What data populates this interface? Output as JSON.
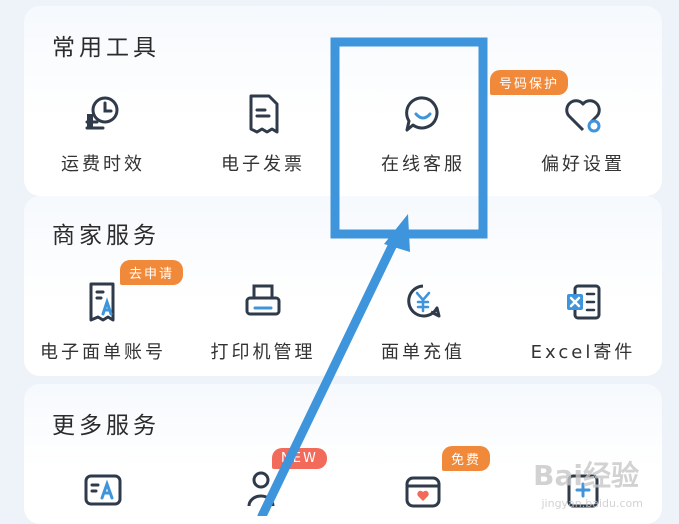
{
  "sections": [
    {
      "title": "常用工具",
      "items": [
        {
          "label": "运费时效",
          "icon": "clock-freight-icon"
        },
        {
          "label": "电子发票",
          "icon": "invoice-icon"
        },
        {
          "label": "在线客服",
          "icon": "chat-service-icon"
        },
        {
          "label": "偏好设置",
          "icon": "heart-settings-icon",
          "badge": "号码保护"
        }
      ]
    },
    {
      "title": "商家服务",
      "items": [
        {
          "label": "电子面单账号",
          "icon": "waybill-account-icon",
          "badge": "去申请"
        },
        {
          "label": "打印机管理",
          "icon": "printer-icon"
        },
        {
          "label": "面单充值",
          "icon": "recharge-icon"
        },
        {
          "label": "Excel寄件",
          "icon": "excel-icon"
        }
      ]
    },
    {
      "title": "更多服务",
      "items": [
        {
          "label": "",
          "icon": "id-card-icon"
        },
        {
          "label": "",
          "icon": "person-icon",
          "badge": "NEW"
        },
        {
          "label": "",
          "icon": "gift-box-icon",
          "badge": "免费"
        },
        {
          "label": "",
          "icon": "calendar-icon"
        }
      ]
    }
  ],
  "watermark": {
    "text": "Bai经验",
    "sub": "jingyan.baidu.com"
  },
  "colors": {
    "accent": "#3f95db",
    "badge": "#f08a3a",
    "icon": "#2f3a4a",
    "annotation": "#3f95db"
  }
}
